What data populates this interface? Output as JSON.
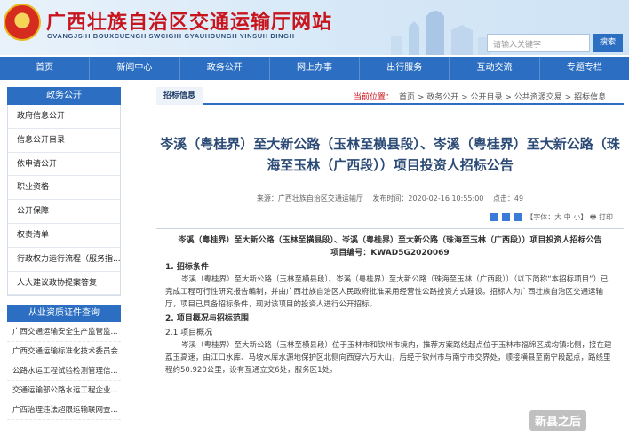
{
  "header": {
    "site_title": "广西壮族自治区交通运输厅网站",
    "site_subtitle": "GVANGJSIH BOUXCUENGH SWCIGIH GYAUHDUNGH YINSUH DINGH",
    "search_placeholder": "请输入关键字",
    "search_button": "搜索"
  },
  "nav": [
    "首页",
    "新闻中心",
    "政务公开",
    "网上办事",
    "出行服务",
    "互动交流",
    "专题专栏"
  ],
  "sidebar": {
    "section1_title": "政务公开",
    "items": [
      "政府信息公开",
      "信息公开目录",
      "依申请公开",
      "职业资格",
      "公开保障",
      "权责清单",
      "行政权力运行流程（服务指...",
      "人大建议政协提案答复"
    ],
    "section2_title": "从业资质证件查询",
    "items2": [
      "广西交通运输安全生产监管监...",
      "广西交通运输标准化技术委员会",
      "公路水运工程试验检测管理信...",
      "交通运输部公路水运工程企业...",
      "广西治理违法超限运输联网查..."
    ]
  },
  "main": {
    "tab": "招标信息",
    "crumb_label": "当前位置：",
    "crumb_path": "首页 > 政务公开 > 公开目录 > 公共资源交易 > 招标信息",
    "title": "岑溪（粤桂界）至大新公路（玉林至横县段）、岑溪（粤桂界）至大新公路（珠海至玉林（广西段））项目投资人招标公告",
    "source": "来源：广西壮族自治区交通运输厅",
    "publish_time": "发布时间：2020-02-16 10:55:00",
    "views": "点击：49",
    "font_size_label": "【字体：大 中 小】",
    "print_label": "打印",
    "body_title": "岑溪（粤桂界）至大新公路（玉林至横县段）、岑溪（粤桂界）至大新公路（珠海至玉林（广西段））项目投资人招标公告",
    "project_code": "项目编号：KWAD5G2020069",
    "section1_heading": "1. 招标条件",
    "section1_text": "岑溪（粤桂界）至大新公路（玉林至横县段）、岑溪（粤桂界）至大新公路（珠海至玉林（广西段））（以下简称“本招标项目”）已完成工程可行性研究报告编制，并由广西壮族自治区人民政府批准采用经营性公路投资方式建设。招标人为广西壮族自治区交通运输厅，项目已具备招标条件，现对该项目的投资人进行公开招标。",
    "section2_heading": "2. 项目概况与招标范围",
    "section2_sub": "2.1 项目概况",
    "section2_text": "岑溪（粤桂界）至大新公路（玉林至横县段）位于玉林市和钦州市境内，推荐方案路线起点位于玉林市福绵区成均镇北侧，接在建荔玉高速，由江口水库、马坡水库水源地保护区北侧向西穿六万大山，后经于钦州市与南宁市交界处，顺接横县至南宁段起点，路线里程约50.920公里，设有互通立交6处，服务区1处。"
  },
  "watermark": "新县之后"
}
